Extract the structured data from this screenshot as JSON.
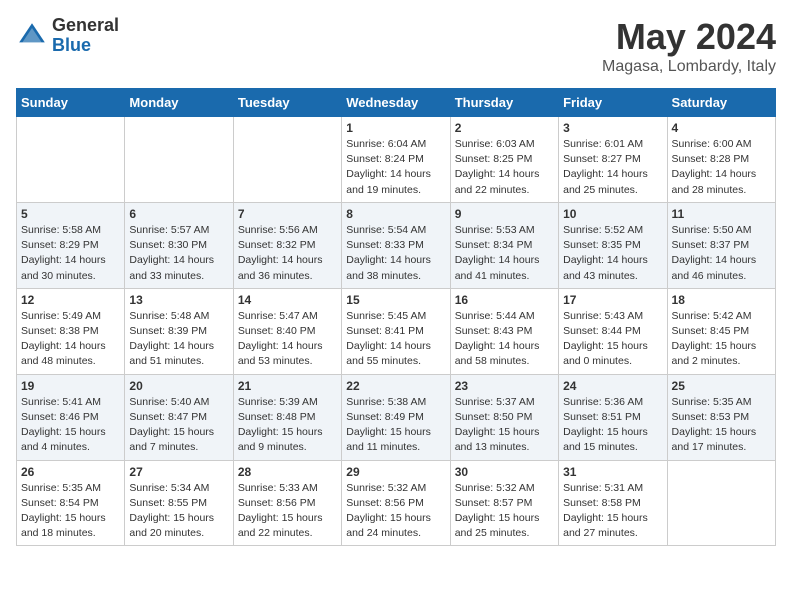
{
  "header": {
    "logo_general": "General",
    "logo_blue": "Blue",
    "title": "May 2024",
    "location": "Magasa, Lombardy, Italy"
  },
  "weekdays": [
    "Sunday",
    "Monday",
    "Tuesday",
    "Wednesday",
    "Thursday",
    "Friday",
    "Saturday"
  ],
  "weeks": [
    [
      {
        "day": "",
        "content": ""
      },
      {
        "day": "",
        "content": ""
      },
      {
        "day": "",
        "content": ""
      },
      {
        "day": "1",
        "content": "Sunrise: 6:04 AM\nSunset: 8:24 PM\nDaylight: 14 hours\nand 19 minutes."
      },
      {
        "day": "2",
        "content": "Sunrise: 6:03 AM\nSunset: 8:25 PM\nDaylight: 14 hours\nand 22 minutes."
      },
      {
        "day": "3",
        "content": "Sunrise: 6:01 AM\nSunset: 8:27 PM\nDaylight: 14 hours\nand 25 minutes."
      },
      {
        "day": "4",
        "content": "Sunrise: 6:00 AM\nSunset: 8:28 PM\nDaylight: 14 hours\nand 28 minutes."
      }
    ],
    [
      {
        "day": "5",
        "content": "Sunrise: 5:58 AM\nSunset: 8:29 PM\nDaylight: 14 hours\nand 30 minutes."
      },
      {
        "day": "6",
        "content": "Sunrise: 5:57 AM\nSunset: 8:30 PM\nDaylight: 14 hours\nand 33 minutes."
      },
      {
        "day": "7",
        "content": "Sunrise: 5:56 AM\nSunset: 8:32 PM\nDaylight: 14 hours\nand 36 minutes."
      },
      {
        "day": "8",
        "content": "Sunrise: 5:54 AM\nSunset: 8:33 PM\nDaylight: 14 hours\nand 38 minutes."
      },
      {
        "day": "9",
        "content": "Sunrise: 5:53 AM\nSunset: 8:34 PM\nDaylight: 14 hours\nand 41 minutes."
      },
      {
        "day": "10",
        "content": "Sunrise: 5:52 AM\nSunset: 8:35 PM\nDaylight: 14 hours\nand 43 minutes."
      },
      {
        "day": "11",
        "content": "Sunrise: 5:50 AM\nSunset: 8:37 PM\nDaylight: 14 hours\nand 46 minutes."
      }
    ],
    [
      {
        "day": "12",
        "content": "Sunrise: 5:49 AM\nSunset: 8:38 PM\nDaylight: 14 hours\nand 48 minutes."
      },
      {
        "day": "13",
        "content": "Sunrise: 5:48 AM\nSunset: 8:39 PM\nDaylight: 14 hours\nand 51 minutes."
      },
      {
        "day": "14",
        "content": "Sunrise: 5:47 AM\nSunset: 8:40 PM\nDaylight: 14 hours\nand 53 minutes."
      },
      {
        "day": "15",
        "content": "Sunrise: 5:45 AM\nSunset: 8:41 PM\nDaylight: 14 hours\nand 55 minutes."
      },
      {
        "day": "16",
        "content": "Sunrise: 5:44 AM\nSunset: 8:43 PM\nDaylight: 14 hours\nand 58 minutes."
      },
      {
        "day": "17",
        "content": "Sunrise: 5:43 AM\nSunset: 8:44 PM\nDaylight: 15 hours\nand 0 minutes."
      },
      {
        "day": "18",
        "content": "Sunrise: 5:42 AM\nSunset: 8:45 PM\nDaylight: 15 hours\nand 2 minutes."
      }
    ],
    [
      {
        "day": "19",
        "content": "Sunrise: 5:41 AM\nSunset: 8:46 PM\nDaylight: 15 hours\nand 4 minutes."
      },
      {
        "day": "20",
        "content": "Sunrise: 5:40 AM\nSunset: 8:47 PM\nDaylight: 15 hours\nand 7 minutes."
      },
      {
        "day": "21",
        "content": "Sunrise: 5:39 AM\nSunset: 8:48 PM\nDaylight: 15 hours\nand 9 minutes."
      },
      {
        "day": "22",
        "content": "Sunrise: 5:38 AM\nSunset: 8:49 PM\nDaylight: 15 hours\nand 11 minutes."
      },
      {
        "day": "23",
        "content": "Sunrise: 5:37 AM\nSunset: 8:50 PM\nDaylight: 15 hours\nand 13 minutes."
      },
      {
        "day": "24",
        "content": "Sunrise: 5:36 AM\nSunset: 8:51 PM\nDaylight: 15 hours\nand 15 minutes."
      },
      {
        "day": "25",
        "content": "Sunrise: 5:35 AM\nSunset: 8:53 PM\nDaylight: 15 hours\nand 17 minutes."
      }
    ],
    [
      {
        "day": "26",
        "content": "Sunrise: 5:35 AM\nSunset: 8:54 PM\nDaylight: 15 hours\nand 18 minutes."
      },
      {
        "day": "27",
        "content": "Sunrise: 5:34 AM\nSunset: 8:55 PM\nDaylight: 15 hours\nand 20 minutes."
      },
      {
        "day": "28",
        "content": "Sunrise: 5:33 AM\nSunset: 8:56 PM\nDaylight: 15 hours\nand 22 minutes."
      },
      {
        "day": "29",
        "content": "Sunrise: 5:32 AM\nSunset: 8:56 PM\nDaylight: 15 hours\nand 24 minutes."
      },
      {
        "day": "30",
        "content": "Sunrise: 5:32 AM\nSunset: 8:57 PM\nDaylight: 15 hours\nand 25 minutes."
      },
      {
        "day": "31",
        "content": "Sunrise: 5:31 AM\nSunset: 8:58 PM\nDaylight: 15 hours\nand 27 minutes."
      },
      {
        "day": "",
        "content": ""
      }
    ]
  ]
}
